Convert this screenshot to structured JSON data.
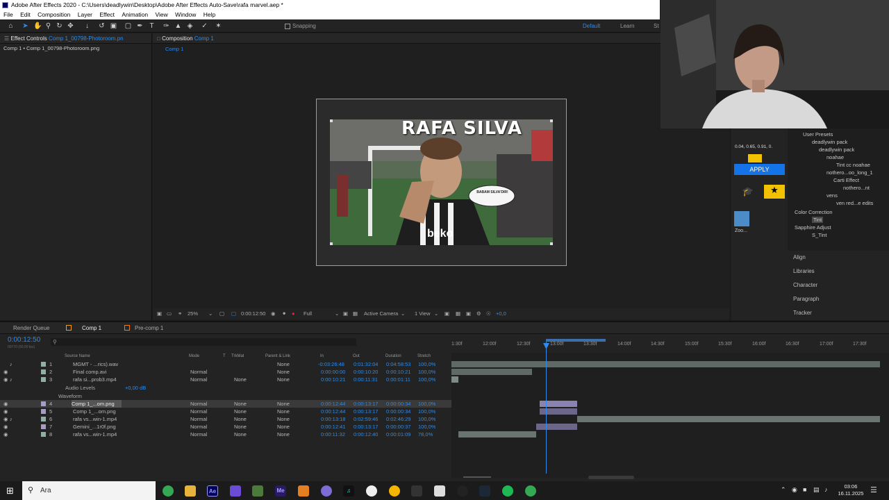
{
  "window": {
    "title": "Adobe After Effects 2020 - C:\\Users\\deadlywin\\Desktop\\Adobe After Effects Auto-Save\\rafa marvel.aep *"
  },
  "menu": [
    "File",
    "Edit",
    "Composition",
    "Layer",
    "Effect",
    "Animation",
    "View",
    "Window",
    "Help"
  ],
  "toolbar": {
    "snapping": "Snapping",
    "workspace_default": "Default",
    "workspace_learn": "Learn",
    "workspace_std": "St"
  },
  "effect_controls": {
    "tab": "Effect Controls",
    "tab_file": "Comp 1_00798-Photoroom.pn",
    "breadcrumb": "Comp 1 • Comp 1_00798-Photoroom.png"
  },
  "composition": {
    "tab": "Composition",
    "tab_name": "Comp 1",
    "subtab": "Comp 1"
  },
  "image": {
    "headline": "RAFA SILVA",
    "bubble": "BABAM SILVA'DIR!",
    "sponsor": "beko"
  },
  "viewer": {
    "zoom": "25%",
    "timecode": "0:00:12:50",
    "resolution": "Full",
    "camera": "Active Camera",
    "views": "1 View",
    "exposure": "+0,0"
  },
  "tint_panel": {
    "values": "0.04, 0.65, 0.91, 0.",
    "apply": "APPLY",
    "zoo": "Zoo..."
  },
  "effects_tree": [
    {
      "label": "User Presets",
      "level": 0
    },
    {
      "label": "deadlywin pack",
      "level": 1
    },
    {
      "label": "deadlywin pack",
      "level": 2
    },
    {
      "label": "noahae",
      "level": 3
    },
    {
      "label": "Tint cc noahae",
      "level": 4
    },
    {
      "label": "nothero...oo_long_1",
      "level": 3
    },
    {
      "label": "Carti Effect",
      "level": 4
    },
    {
      "label": "nothero...nt",
      "level": 5
    },
    {
      "label": "vens",
      "level": 3
    },
    {
      "label": "ven red...e edits",
      "level": 4
    },
    {
      "label": "Color Correction",
      "level": 0
    },
    {
      "label": "Tint",
      "level": 1
    },
    {
      "label": "Sapphire Adjust",
      "level": 0
    },
    {
      "label": "S_Tint",
      "level": 1
    }
  ],
  "side_panels": [
    "Align",
    "Libraries",
    "Character",
    "Paragraph",
    "Tracker"
  ],
  "timeline": {
    "tabs": {
      "render": "Render Queue",
      "comp": "Comp 1",
      "precomp": "Pre-comp 1"
    },
    "current_time": "0:00:12:50",
    "current_frames": "00770 (60.00 fps)",
    "headers": {
      "source": "Source Name",
      "mode": "Mode",
      "t": "T",
      "trkmat": "TrkMat",
      "parent": "Parent & Link",
      "in": "In",
      "out": "Out",
      "duration": "Duration",
      "stretch": "Stretch"
    },
    "ruler": [
      "1:30f",
      "12:00f",
      "12:30f",
      "13:00f",
      "13:30f",
      "14:00f",
      "14:30f",
      "15:00f",
      "15:30f",
      "16:00f",
      "16:30f",
      "17:00f",
      "17:30f"
    ],
    "audio_levels": "Audio Levels",
    "audio_value": "+0,00 dB",
    "waveform": "Waveform",
    "layers": [
      {
        "num": "1",
        "name": "MGMT - ...rics).wav",
        "mode": "",
        "trkmat": "",
        "parent": "None",
        "in": "-0:03:26:48",
        "out": "0:01:32:04",
        "dur": "0:04:58:53",
        "stretch": "100,0%",
        "color": "#8fb0a8"
      },
      {
        "num": "2",
        "name": "Final comp.avi",
        "mode": "Normal",
        "trkmat": "",
        "parent": "None",
        "in": "0:00:00:00",
        "out": "0:00:10:20",
        "dur": "0:00:10:21",
        "stretch": "100,0%",
        "color": "#8fb0a8"
      },
      {
        "num": "3",
        "name": "rafa si...prob3.mp4",
        "mode": "Normal",
        "trkmat": "None",
        "parent": "None",
        "in": "0:00:10:21",
        "out": "0:00:11:31",
        "dur": "0:00:01:11",
        "stretch": "100,0%",
        "color": "#8fb0a8"
      },
      {
        "num": "4",
        "name": "Comp 1_...om.png",
        "mode": "Normal",
        "trkmat": "None",
        "parent": "None",
        "in": "0:00:12:44",
        "out": "0:00:13:17",
        "dur": "0:00:00:34",
        "stretch": "100,0%",
        "color": "#a69bc9"
      },
      {
        "num": "5",
        "name": "Comp 1_...om.png",
        "mode": "Normal",
        "trkmat": "None",
        "parent": "None",
        "in": "0:00:12:44",
        "out": "0:00:13:17",
        "dur": "0:00:00:34",
        "stretch": "100,0%",
        "color": "#a69bc9"
      },
      {
        "num": "6",
        "name": "rafa vs...win-1.mp4",
        "mode": "Normal",
        "trkmat": "None",
        "parent": "None",
        "in": "0:00:13:18",
        "out": "0:02:59:46",
        "dur": "0:02:46:29",
        "stretch": "100,0%",
        "color": "#8fb0a8"
      },
      {
        "num": "7",
        "name": "Gemini_...1r0f.png",
        "mode": "Normal",
        "trkmat": "None",
        "parent": "None",
        "in": "0:00:12:41",
        "out": "0:00:13:17",
        "dur": "0:00:00:37",
        "stretch": "100,0%",
        "color": "#a69bc9"
      },
      {
        "num": "8",
        "name": "rafa vs...win-1.mp4",
        "mode": "Normal",
        "trkmat": "None",
        "parent": "None",
        "in": "0:00:11:32",
        "out": "0:00:12:40",
        "dur": "0:00:01:09",
        "stretch": "78,0%",
        "color": "#8fb0a8"
      }
    ]
  },
  "taskbar": {
    "search": "Ara",
    "time": "03:06",
    "date": "16.11.2025"
  }
}
